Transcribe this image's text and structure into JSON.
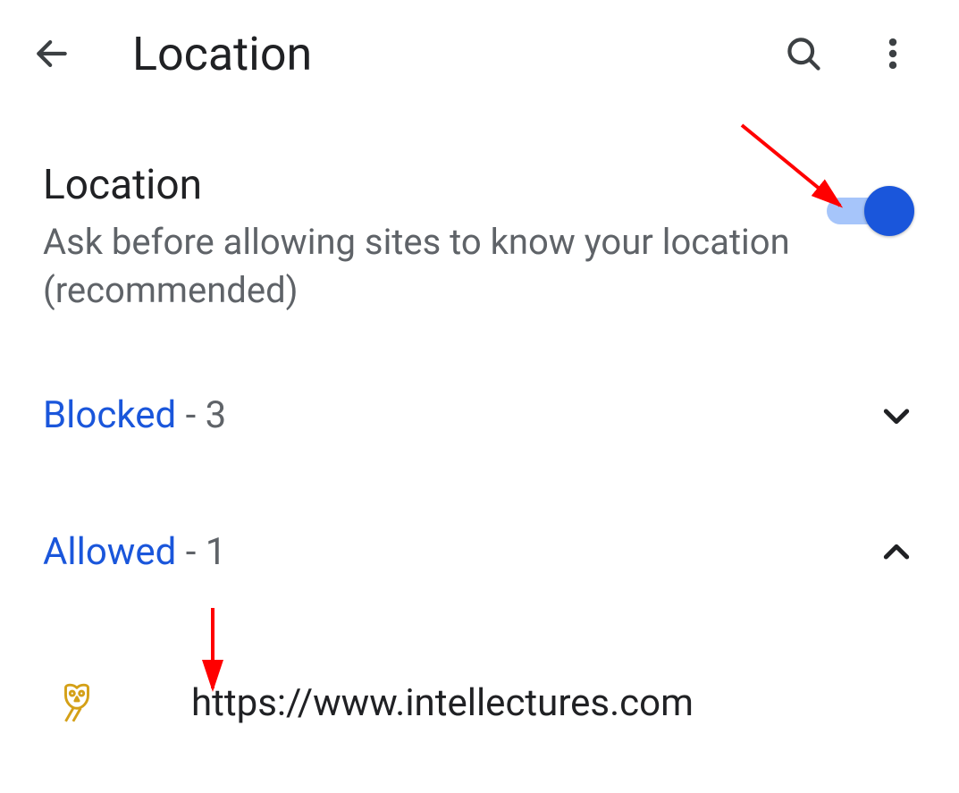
{
  "appbar": {
    "title": "Location"
  },
  "setting": {
    "title": "Location",
    "description": "Ask before allowing sites to know your location (recommended)",
    "toggle_on": true
  },
  "sections": {
    "blocked": {
      "label": "Blocked",
      "count": 3,
      "expanded": false
    },
    "allowed": {
      "label": "Allowed",
      "count": 1,
      "expanded": true
    }
  },
  "allowed_sites": [
    {
      "url": "https://www.intellectures.com",
      "favicon": "owl"
    }
  ]
}
